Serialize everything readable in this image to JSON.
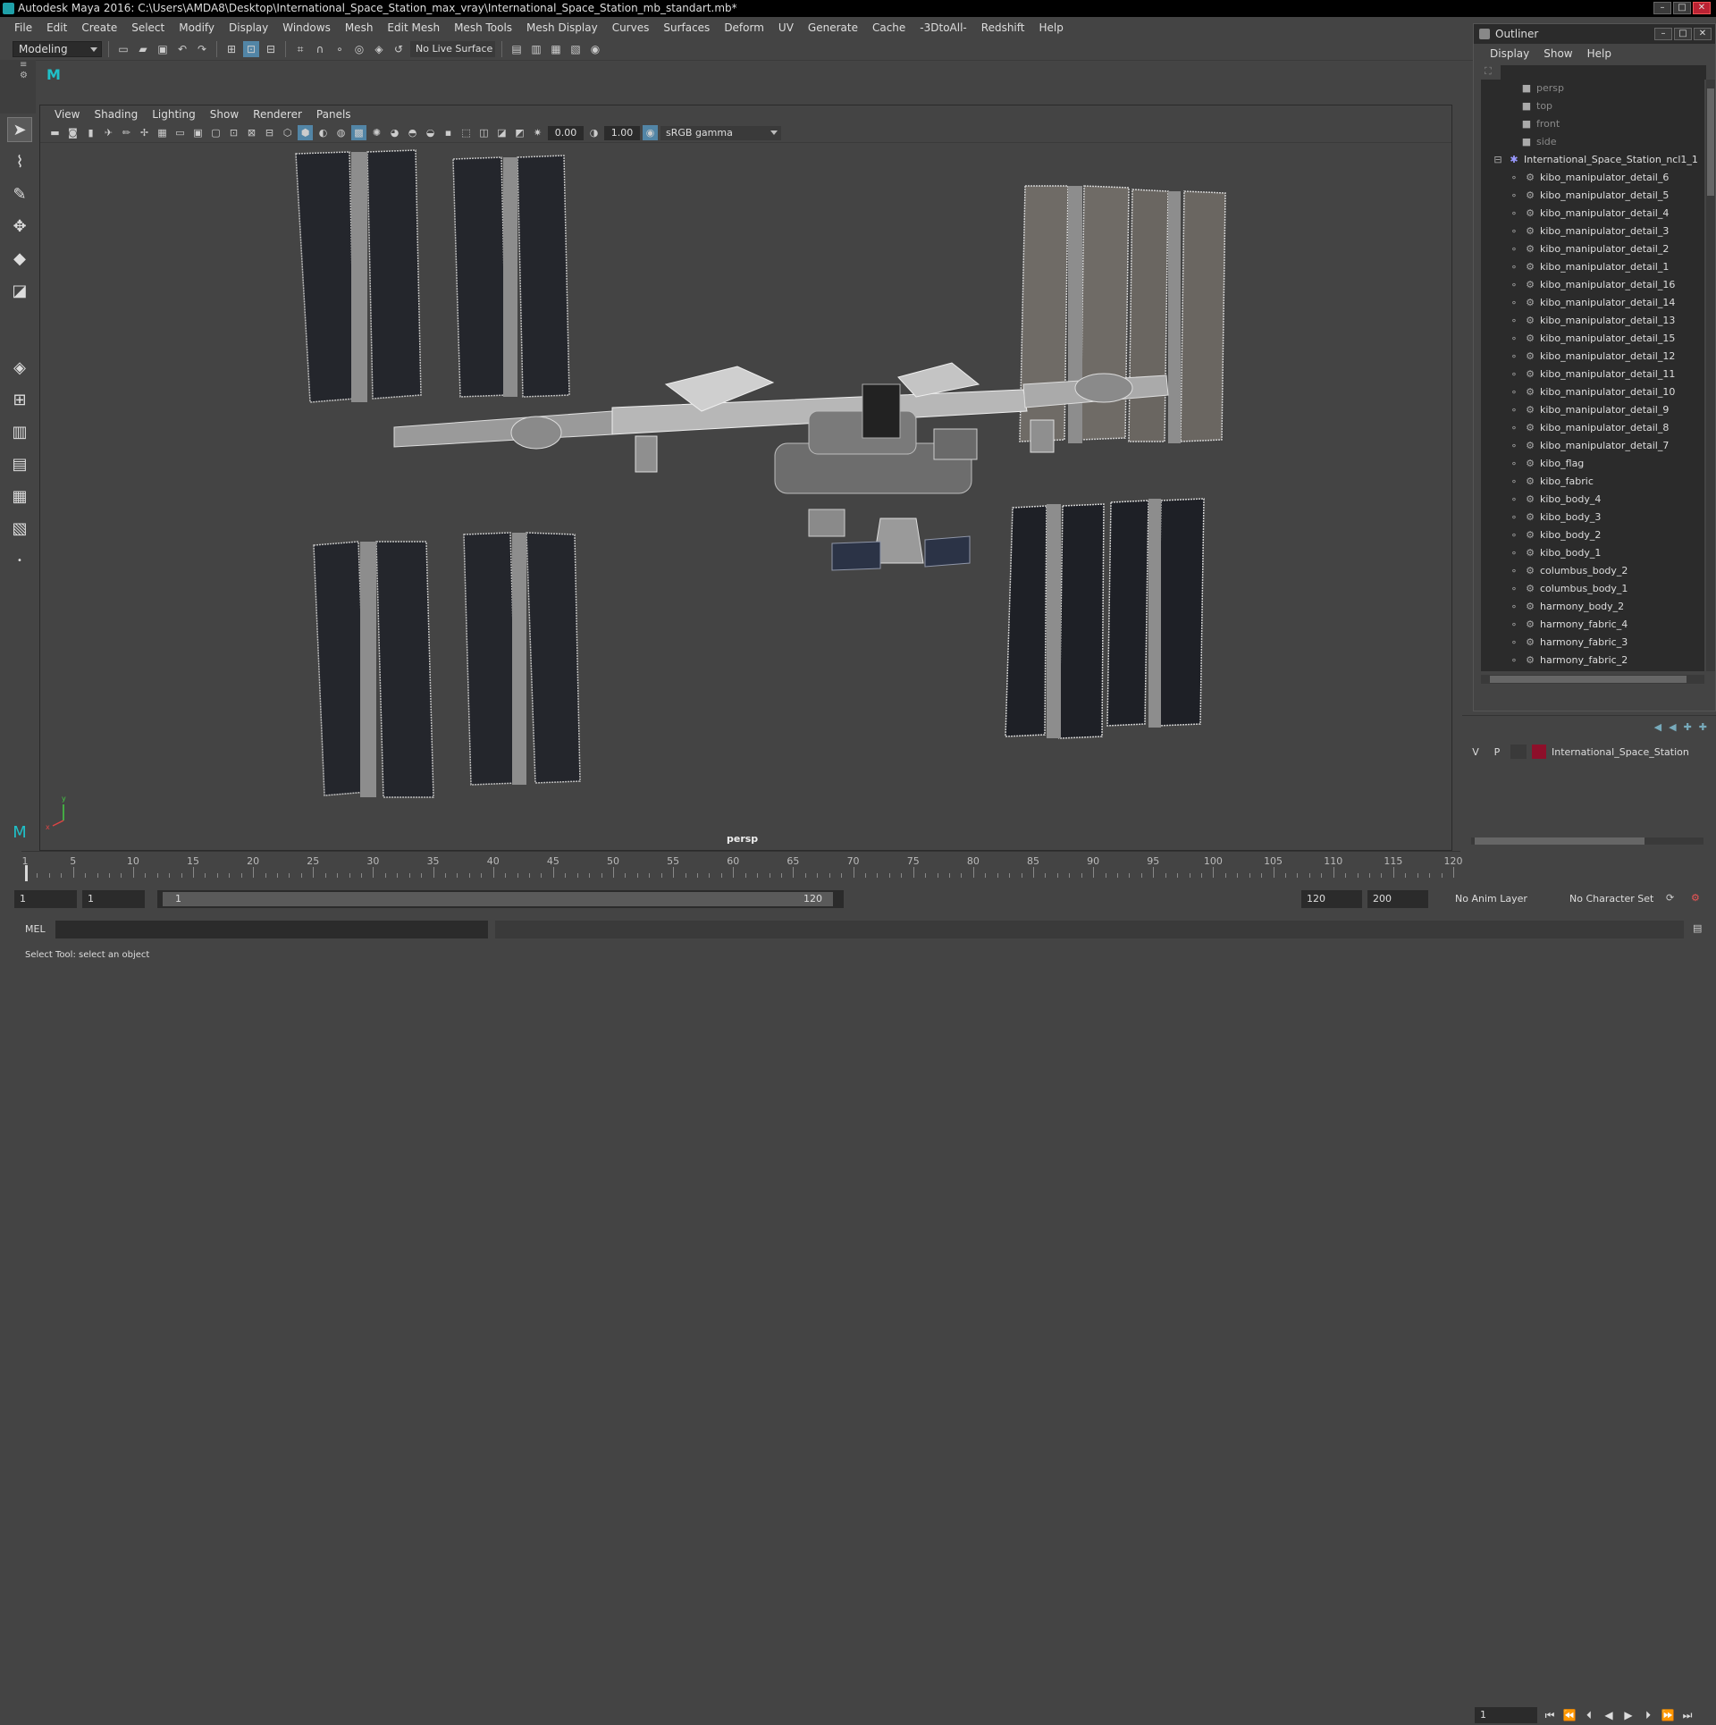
{
  "window": {
    "title": "Autodesk Maya 2016: C:\\Users\\AMDA8\\Desktop\\International_Space_Station_max_vray\\International_Space_Station_mb_standart.mb*"
  },
  "menubar": [
    "File",
    "Edit",
    "Create",
    "Select",
    "Modify",
    "Display",
    "Windows",
    "Mesh",
    "Edit Mesh",
    "Mesh Tools",
    "Mesh Display",
    "Curves",
    "Surfaces",
    "Deform",
    "UV",
    "Generate",
    "Cache",
    "-3DtoAll-",
    "Redshift",
    "Help"
  ],
  "toolbar": {
    "mode": "Modeling",
    "live_surface": "No Live Surface"
  },
  "viewport": {
    "menus": [
      "View",
      "Shading",
      "Lighting",
      "Show",
      "Renderer",
      "Panels"
    ],
    "exposure": "0.00",
    "gamma": "1.00",
    "color_space": "sRGB gamma",
    "camera": "persp"
  },
  "outliner": {
    "title": "Outliner",
    "menus": [
      "Display",
      "Show",
      "Help"
    ],
    "cameras": [
      "persp",
      "top",
      "front",
      "side"
    ],
    "root": "International_Space_Station_ncl1_1",
    "items": [
      "kibo_manipulator_detail_6",
      "kibo_manipulator_detail_5",
      "kibo_manipulator_detail_4",
      "kibo_manipulator_detail_3",
      "kibo_manipulator_detail_2",
      "kibo_manipulator_detail_1",
      "kibo_manipulator_detail_16",
      "kibo_manipulator_detail_14",
      "kibo_manipulator_detail_13",
      "kibo_manipulator_detail_15",
      "kibo_manipulator_detail_12",
      "kibo_manipulator_detail_11",
      "kibo_manipulator_detail_10",
      "kibo_manipulator_detail_9",
      "kibo_manipulator_detail_8",
      "kibo_manipulator_detail_7",
      "kibo_flag",
      "kibo_fabric",
      "kibo_body_4",
      "kibo_body_3",
      "kibo_body_2",
      "kibo_body_1",
      "columbus_body_2",
      "columbus_body_1",
      "harmony_body_2",
      "harmony_fabric_4",
      "harmony_fabric_3",
      "harmony_fabric_2"
    ]
  },
  "layers": {
    "v": "V",
    "p": "P",
    "name": "International_Space_Station",
    "color": "#8d0f2a"
  },
  "timeline": {
    "ticks": [
      "1",
      "5",
      "10",
      "15",
      "20",
      "25",
      "30",
      "35",
      "40",
      "45",
      "50",
      "55",
      "60",
      "65",
      "70",
      "75",
      "80",
      "85",
      "90",
      "95",
      "100",
      "105",
      "110",
      "115",
      "120"
    ],
    "current_frame": "1"
  },
  "range": {
    "start": "1",
    "start2": "1",
    "inner_start": "1",
    "inner_end": "120",
    "end": "120",
    "end2": "200",
    "anim_layer": "No Anim Layer",
    "char_set": "No Character Set"
  },
  "mel": {
    "label": "MEL"
  },
  "help": {
    "text": "Select Tool: select an object"
  }
}
